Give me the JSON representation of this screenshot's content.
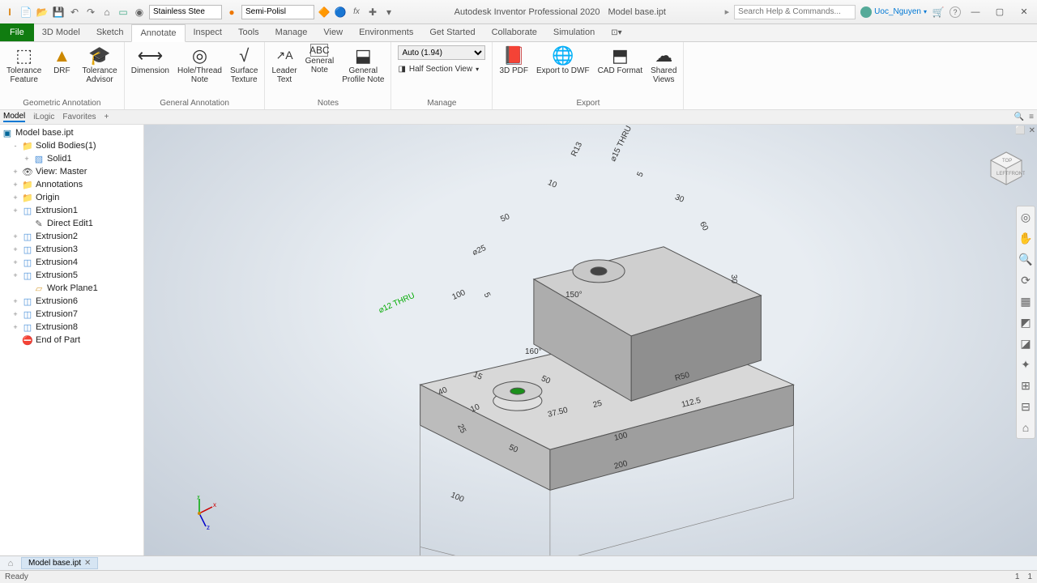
{
  "app": {
    "title": "Autodesk Inventor Professional 2020",
    "document": "Model base.ipt",
    "search_placeholder": "Search Help & Commands...",
    "user": "Uoc_Nguyen",
    "status": "Ready",
    "status_right": [
      "1",
      "1"
    ],
    "material_dropdown": "Stainless Stee",
    "appearance_dropdown": "Semi-Polisl"
  },
  "ribbon": {
    "file": "File",
    "tabs": [
      "3D Model",
      "Sketch",
      "Annotate",
      "Inspect",
      "Tools",
      "Manage",
      "View",
      "Environments",
      "Get Started",
      "Collaborate",
      "Simulation"
    ],
    "active_tab": "Annotate",
    "groups": {
      "geo": {
        "label": "Geometric Annotation",
        "buttons": {
          "tol_feat": "Tolerance\nFeature",
          "drf": "DRF",
          "tol_adv": "Tolerance\nAdvisor"
        }
      },
      "gen": {
        "label": "General Annotation",
        "buttons": {
          "dim": "Dimension",
          "hole": "Hole/Thread\nNote",
          "surf": "Surface\nTexture"
        }
      },
      "notes": {
        "label": "Notes",
        "buttons": {
          "leader": "Leader\nText",
          "gnote": "General\nNote",
          "pnote": "General\nProfile Note"
        }
      },
      "manage": {
        "label": "Manage",
        "combo": "Auto (1.94)",
        "section": "Half Section View"
      },
      "export": {
        "label": "Export",
        "buttons": {
          "pdf": "3D PDF",
          "dwf": "Export to DWF",
          "cad": "CAD Format",
          "shared": "Shared\nViews"
        }
      }
    }
  },
  "panel_tabs": {
    "items": [
      "Model",
      "iLogic",
      "Favorites"
    ],
    "active": "Model"
  },
  "tree": {
    "root": "Model base.ipt",
    "items": [
      {
        "label": "Solid Bodies(1)",
        "icon": "folder",
        "exp": "-",
        "indent": 1
      },
      {
        "label": "Solid1",
        "icon": "solid",
        "exp": "+",
        "indent": 2
      },
      {
        "label": "View: Master",
        "icon": "view",
        "exp": "+",
        "indent": 1
      },
      {
        "label": "Annotations",
        "icon": "folder",
        "exp": "+",
        "indent": 1
      },
      {
        "label": "Origin",
        "icon": "folder",
        "exp": "+",
        "indent": 1
      },
      {
        "label": "Extrusion1",
        "icon": "ext",
        "exp": "+",
        "indent": 1
      },
      {
        "label": "Direct Edit1",
        "icon": "edit",
        "exp": "",
        "indent": 2
      },
      {
        "label": "Extrusion2",
        "icon": "ext",
        "exp": "+",
        "indent": 1
      },
      {
        "label": "Extrusion3",
        "icon": "ext",
        "exp": "+",
        "indent": 1
      },
      {
        "label": "Extrusion4",
        "icon": "ext",
        "exp": "+",
        "indent": 1
      },
      {
        "label": "Extrusion5",
        "icon": "ext",
        "exp": "+",
        "indent": 1
      },
      {
        "label": "Work Plane1",
        "icon": "plane",
        "exp": "",
        "indent": 2
      },
      {
        "label": "Extrusion6",
        "icon": "ext",
        "exp": "+",
        "indent": 1
      },
      {
        "label": "Extrusion7",
        "icon": "ext",
        "exp": "+",
        "indent": 1
      },
      {
        "label": "Extrusion8",
        "icon": "ext",
        "exp": "+",
        "indent": 1
      },
      {
        "label": "End of Part",
        "icon": "end",
        "exp": "",
        "indent": 1
      }
    ]
  },
  "doc_tab": "Model base.ipt",
  "dimensions": {
    "r13": "R13",
    "d15": "⌀15 THRU",
    "d5": "5",
    "d30": "30",
    "d60": "60",
    "d10": "10",
    "d50a": "50",
    "d25": "⌀25",
    "d100a": "100",
    "a150": "150°",
    "d12": "⌀12 THRU",
    "d5b": "5",
    "a160": "160°",
    "d15b": "15",
    "d50b": "50",
    "r50": "R50",
    "d40": "40",
    "d10b": "10",
    "d25b": "25",
    "d50c": "50",
    "d37": "37.50",
    "d25c": "25",
    "d112": "112.5",
    "d100b": "100",
    "d100c": "100",
    "d200": "200",
    "d30b": "30"
  }
}
